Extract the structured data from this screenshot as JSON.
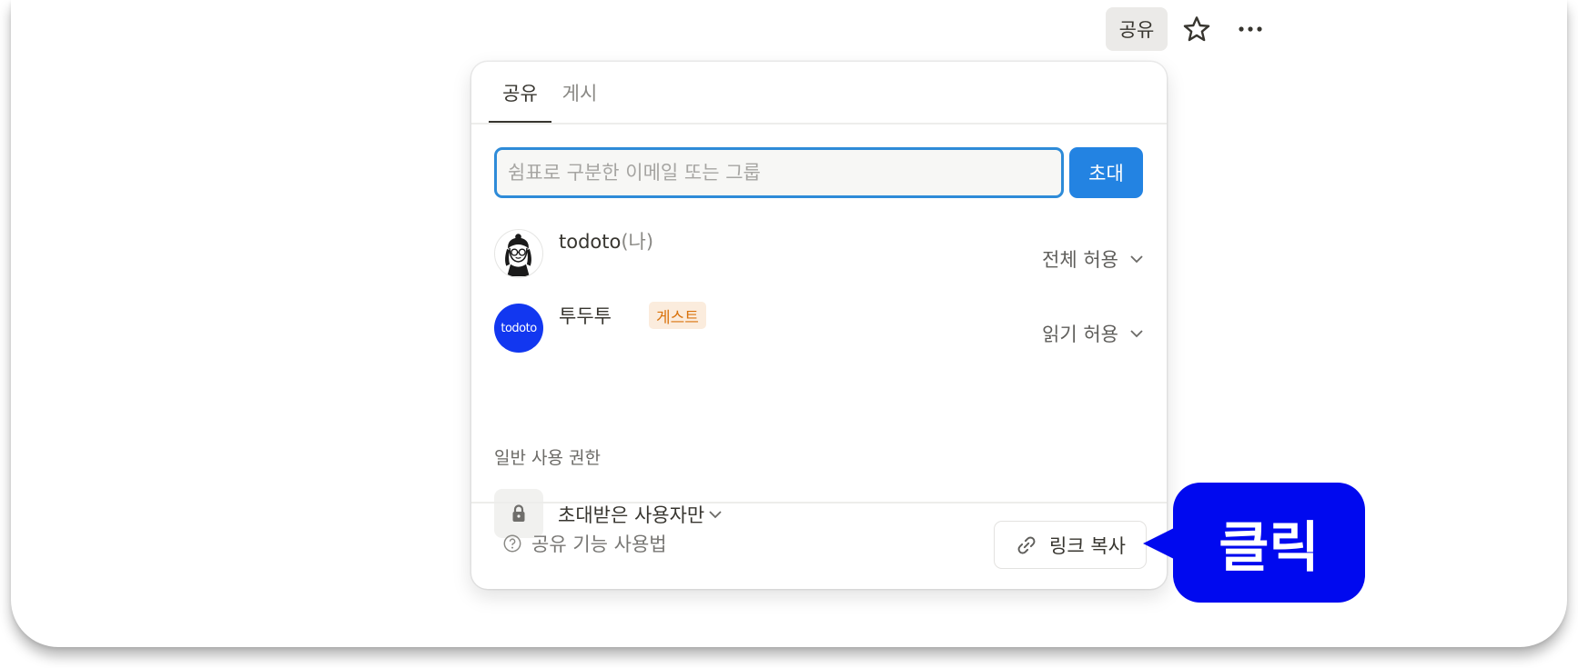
{
  "toolbar": {
    "share_label": "공유",
    "favorite_icon": "star-icon",
    "more_icon": "more-dots-icon"
  },
  "share_panel": {
    "tabs": [
      {
        "label": "공유",
        "active": true
      },
      {
        "label": "게시",
        "active": false
      }
    ],
    "invite": {
      "value": "",
      "placeholder": "쉼표로 구분한 이메일 또는 그룹",
      "button_label": "초대"
    },
    "members": [
      {
        "name": "todoto",
        "me_suffix": "(나)",
        "permission": "전체 허용",
        "avatar": "illustrated-person"
      },
      {
        "name": "투두투",
        "badge": "게스트",
        "permission": "읽기 허용",
        "avatar_text": "todoto"
      }
    ],
    "general_access": {
      "label": "일반 사용 권한",
      "value": "초대받은 사용자만",
      "icon": "lock-icon"
    },
    "footer": {
      "help_label": "공유 기능 사용법",
      "copy_link_label": "링크 복사"
    }
  },
  "callout": {
    "text": "클릭",
    "color": "#0009ef"
  },
  "colors": {
    "accent": "#2383e2",
    "guest_badge_bg": "#fbecdd",
    "guest_badge_text": "#d9730d"
  }
}
